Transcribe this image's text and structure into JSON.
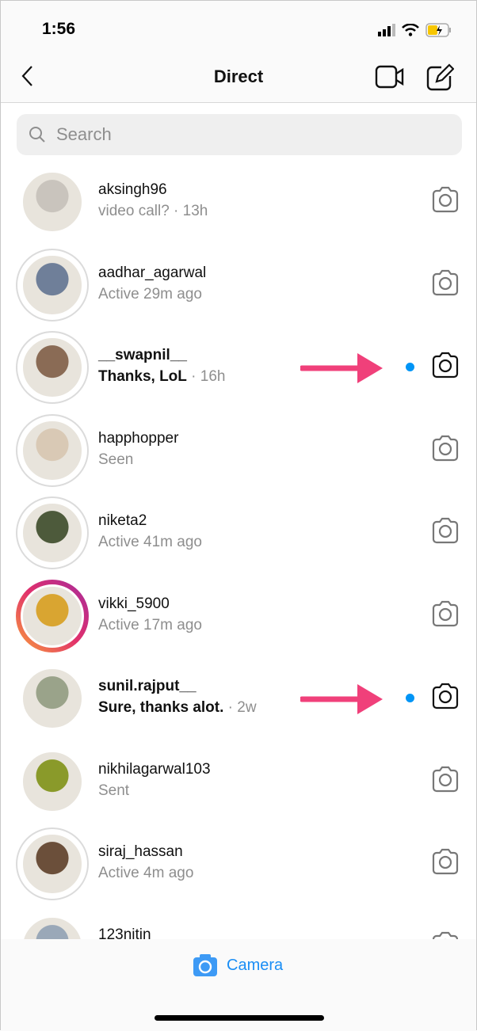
{
  "status": {
    "time": "1:56"
  },
  "header": {
    "title": "Direct"
  },
  "search": {
    "placeholder": "Search"
  },
  "conversations": [
    {
      "username": "aksingh96",
      "subtitle": "video call?",
      "time": "13h",
      "unread": false,
      "ring": "plain",
      "color": "#c9c4bd"
    },
    {
      "username": "aadhar_agarwal",
      "subtitle": "Active 29m ago",
      "time": "",
      "unread": false,
      "ring": "seen",
      "color": "#6f7f99"
    },
    {
      "username": "__swapnil__",
      "subtitle": "Thanks, LoL",
      "time": "16h",
      "unread": true,
      "ring": "seen",
      "color": "#8a6b55"
    },
    {
      "username": "happhopper",
      "subtitle": "Seen",
      "time": "",
      "unread": false,
      "ring": "seen",
      "color": "#d9c9b5"
    },
    {
      "username": "niketa2",
      "subtitle": "Active 41m ago",
      "time": "",
      "unread": false,
      "ring": "seen",
      "color": "#4d5a3b"
    },
    {
      "username": "vikki_5900",
      "subtitle": "Active 17m ago",
      "time": "",
      "unread": false,
      "ring": "story",
      "color": "#d9a531"
    },
    {
      "username": "sunil.rajput__",
      "subtitle": "Sure, thanks alot.",
      "time": "2w",
      "unread": true,
      "ring": "plain",
      "color": "#9aa38a"
    },
    {
      "username": "nikhilagarwal103",
      "subtitle": "Sent",
      "time": "",
      "unread": false,
      "ring": "plain",
      "color": "#8a9a2a"
    },
    {
      "username": "siraj_hassan",
      "subtitle": "Active 4m ago",
      "time": "",
      "unread": false,
      "ring": "seen",
      "color": "#6b4f3a"
    },
    {
      "username": "123nitin",
      "subtitle": "",
      "time": "",
      "unread": false,
      "ring": "plain",
      "color": "#9aa8b8"
    }
  ],
  "footer": {
    "camera_label": "Camera"
  },
  "colors": {
    "accent": "#0095f6",
    "arrow": "#f0407a",
    "story_ring": "#e1306c"
  }
}
